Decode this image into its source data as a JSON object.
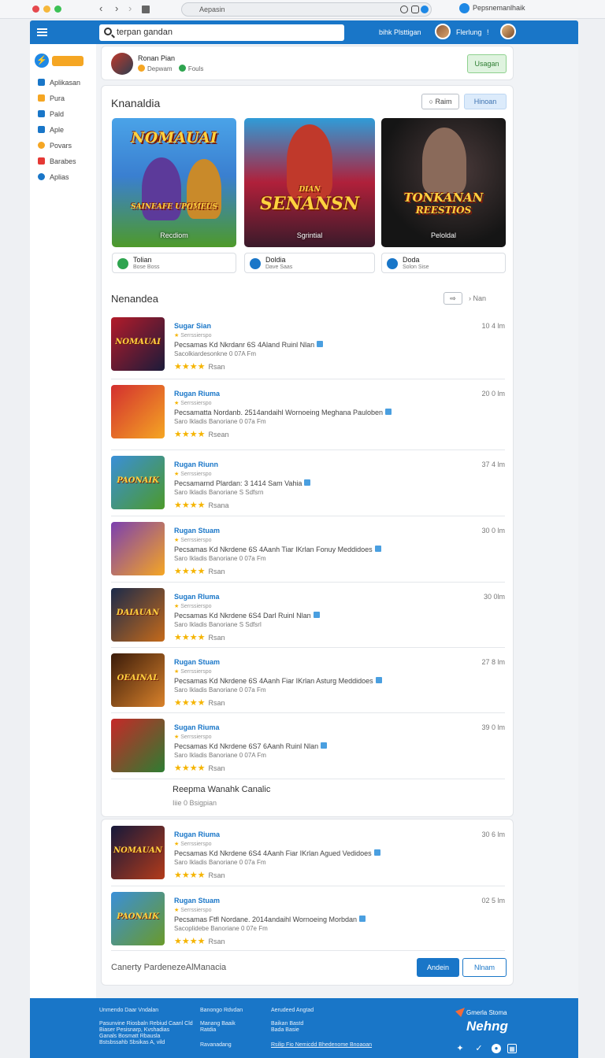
{
  "browser": {
    "url": "Aepasin",
    "profile": "Pepsnemanlhaik"
  },
  "appbar": {
    "search_value": "terpan gandan",
    "link1": "bihk Plsttigan",
    "link2": "Flerlung",
    "link2_suffix": "!"
  },
  "sidebar": {
    "items": [
      {
        "label": "Aplikasan",
        "icon": "apps-icon",
        "color": "#1976c8"
      },
      {
        "label": "Pura",
        "icon": "games-icon",
        "color": "#f5a623"
      },
      {
        "label": "Pald",
        "icon": "book-icon",
        "color": "#1976c8"
      },
      {
        "label": "Aple",
        "icon": "movie-icon",
        "color": "#1976c8"
      },
      {
        "label": "Povars",
        "icon": "star-icon",
        "color": "#f5a623"
      },
      {
        "label": "Barabes",
        "icon": "bookmark-icon",
        "color": "#e53935"
      },
      {
        "label": "Aplias",
        "icon": "globe-icon",
        "color": "#1976c8"
      }
    ]
  },
  "user": {
    "name": "Ronan Pian",
    "meta1": "Depwam",
    "meta2": "Fouls",
    "follow_label": "Usagan"
  },
  "featured": {
    "title": "Knanaldia",
    "btn_outline": "Raim",
    "btn_light": "Hinoan",
    "cards": [
      {
        "logo": "NOMAUAI",
        "tagline": "SAINEAFE UPOMEUS",
        "caption": "Recdiom",
        "bg": "#3a7fd0"
      },
      {
        "logo": "SENANSN",
        "tagline": "DIAN",
        "caption": "Sgrintial",
        "bg": "#b0203a"
      },
      {
        "logo": "TONKANAN",
        "tagline": "REESTIOS",
        "caption": "Peloldal",
        "bg": "#151515"
      }
    ],
    "chips": [
      {
        "t1": "Tolian",
        "t2": "Bose Boss",
        "color": "#2ea44f"
      },
      {
        "t1": "Doldia",
        "t2": "Dave Saas",
        "color": "#1976c8"
      },
      {
        "t1": "Doda",
        "t2": "Solon Sise",
        "color": "#1976c8"
      }
    ]
  },
  "recommended": {
    "title": "Nenandea",
    "more_label": "Nan",
    "rows": [
      {
        "title": "Sugar Sian",
        "sub": "Serrssierspo",
        "desc": "Pecsamas Kd Nkrdanr 6S 4Aland Ruinl Nlan",
        "size": "Sacolkiardesonkne 0 07A Fm",
        "rating": "Rsan",
        "time": "10 4 lm",
        "thumb": [
          "#b31b2a",
          "#1b1b3a"
        ],
        "band": "NOMAUAI"
      },
      {
        "title": "Rugan Riuma",
        "sub": "Serrssierspo",
        "desc": "Pecsamatta Nordanb. 2514andaihl Wornoeing Meghana Pauloben",
        "size": "Saro Ikladis Banoriane 0 07a Fm",
        "rating": "Rsean",
        "time": "20 0 lm",
        "thumb": [
          "#d32f2f",
          "#f5a623"
        ],
        "band": ""
      },
      {
        "title": "Rugan Riunn",
        "sub": "Serrssierspo",
        "desc": "Pecsamarnd Plardan: 3 1414 Sam Vahia",
        "size": "Saro Ikladis Banoriane S Sdfsrn",
        "rating": "Rsana",
        "time": "37 4 lm",
        "thumb": [
          "#3a8fd8",
          "#4c9a2a"
        ],
        "band": "PAONAIK"
      },
      {
        "title": "Rugan Stuam",
        "sub": "Serrssierspo",
        "desc": "Pecsamas Kd Nkrdene 6S 4Aanh Tiar IKrlan Fonuy Meddidoes",
        "size": "Saro Ikladis Banoriane 0 07a Fm",
        "rating": "Rsan",
        "time": "30 0 lm",
        "thumb": [
          "#7b3fb0",
          "#f5a623"
        ],
        "band": ""
      },
      {
        "title": "Sugan Rluma",
        "sub": "Serrssierspo",
        "desc": "Pecsamas Kd Nkrdene 6S4 Darl Ruinl Nlan",
        "size": "Saro Ikladis Banoriane S Sdfsrl",
        "rating": "Rsan",
        "time": "30 0lm",
        "thumb": [
          "#1b2a4a",
          "#c56a1a"
        ],
        "band": "DAIAUAN"
      },
      {
        "title": "Rugan Stuam",
        "sub": "Serrssierspo",
        "desc": "Pecsamas Kd Nkrdene 6S 4Aanh Fiar IKrlan Asturg Meddidoes",
        "size": "Saro Ikladis Banoriane 0 07a Fm",
        "rating": "Rsan",
        "time": "27 8 lm",
        "thumb": [
          "#3a1b0a",
          "#d9822b"
        ],
        "band": "OEAINAL"
      },
      {
        "title": "Sugan Riuma",
        "sub": "Serrssierspo",
        "desc": "Pecsamas Kd Nkrdene 6S7 6Aanh Ruinl Nlan",
        "size": "Saro Ikladis Banoriane 0 07A Fm",
        "rating": "Rsan",
        "time": "39 0 lm",
        "thumb": [
          "#c62828",
          "#2e7d32"
        ],
        "band": ""
      }
    ],
    "subsection": {
      "title": "Reepma Wanahk Canalic",
      "sub": "Iiie 0 Bsigpian"
    },
    "rows2": [
      {
        "title": "Rugan Riuma",
        "sub": "Serrssierspo",
        "desc": "Pecsamas Kd Nkrdene 6S4 4Aanh Fiar IKrlan Agued Vedidoes",
        "size": "Saro Ikladis Banoriane 0 07a Fm",
        "rating": "Rsan",
        "time": "30 6 lm",
        "thumb": [
          "#15183a",
          "#b33b1a"
        ],
        "band": "NOMAUAN"
      },
      {
        "title": "Rugan Stuam",
        "sub": "Serrssierspo",
        "desc": "Pecsamas Ftfl Nordane. 2014andaihl Wornoeing Morbdan",
        "size": "Sacoplidebe Banoriane 0 07e Fm",
        "rating": "Rsan",
        "time": "02 5 lm",
        "thumb": [
          "#3a8fd8",
          "#6a9a2a"
        ],
        "band": "PAONAIK"
      }
    ],
    "bottom_text": "Canerty PardenezeAlManacia",
    "btn_primary": "Andein",
    "btn_secondary": "Nlnam"
  },
  "footer": {
    "col1": [
      "Unmendo Daar Vndalan",
      "Pasunvine Riosbaln Rebiud Caanl Cld",
      "Biaser Pesisnarp, Kvshadias",
      "Ganals Bosmatt Rbausla",
      "Bstsbssahb Sbsikas A, vild"
    ],
    "col2": [
      "Banongo Rdvdan",
      "Manang Baaik",
      "Ratdia",
      "Ravanadang"
    ],
    "col3": [
      "Aerudeed Angtad",
      "Baikan Bastd",
      "Bada Basie"
    ],
    "col3_link": "Rsilip Fio Nemicdd Bhedenome Bnoaoan",
    "brand_small": "Gmerla Stoma",
    "brand_main": "Nehng"
  }
}
